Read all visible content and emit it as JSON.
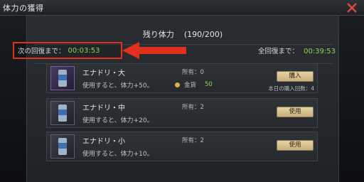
{
  "window": {
    "title": "体力の獲得"
  },
  "stamina": {
    "label": "残り体力",
    "value": "(190/200)"
  },
  "next_recovery": {
    "label": "次の回復まで：",
    "time": "00:03:53"
  },
  "full_recovery": {
    "label": "全回復まで：",
    "time": "00:39:53"
  },
  "items": [
    {
      "name": "エナドリ・大",
      "owned": "所有：0",
      "desc": "使用すると、体力+50。",
      "gold_label": "金貨",
      "gold_amount": "50",
      "button": "購入",
      "purchase_count": "本日の購入回数：4"
    },
    {
      "name": "エナドリ・中",
      "owned": "所有：2",
      "desc": "使用すると、体力+20。",
      "button": "使用"
    },
    {
      "name": "エナドリ・小",
      "owned": "所有：2",
      "desc": "使用すると、体力+10。",
      "button": "使用"
    }
  ],
  "colors": {
    "timer_green": "#8fd14f",
    "highlight_red": "#e0301e",
    "button_gold": "#d8c18f"
  },
  "icons": {
    "close": "close-icon",
    "arrow": "annotation-arrow",
    "coin": "coin-icon",
    "item": "energy-drink-icon"
  }
}
